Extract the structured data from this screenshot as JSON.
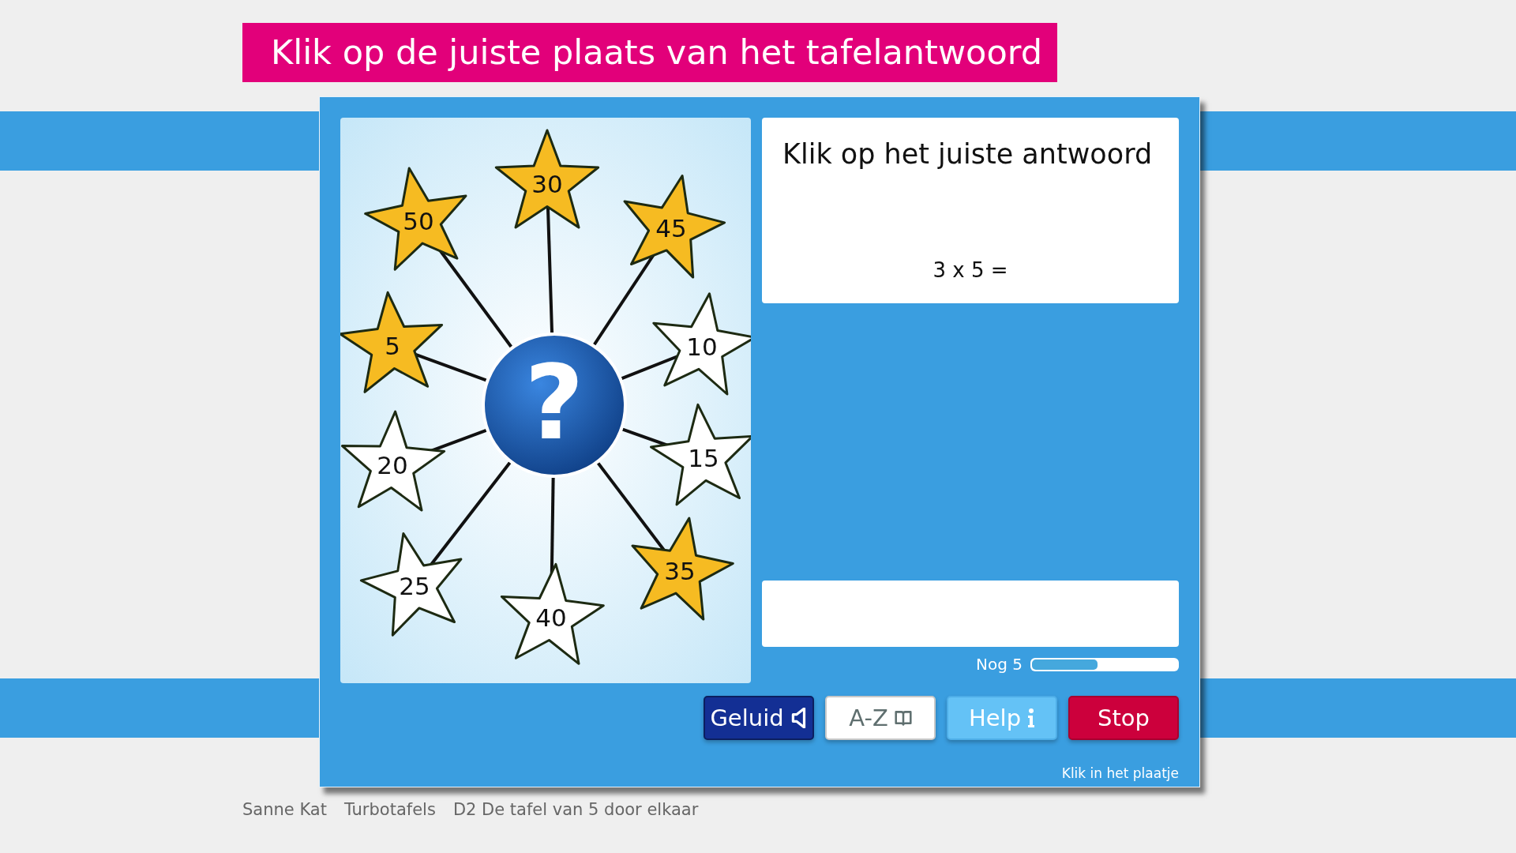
{
  "title": "Klik op de juiste plaats van het tafelantwoord",
  "center_symbol": "?",
  "stars": [
    {
      "label": "30",
      "highlighted": true
    },
    {
      "label": "50",
      "highlighted": true
    },
    {
      "label": "45",
      "highlighted": true
    },
    {
      "label": "5",
      "highlighted": true
    },
    {
      "label": "10",
      "highlighted": false
    },
    {
      "label": "20",
      "highlighted": false
    },
    {
      "label": "15",
      "highlighted": false
    },
    {
      "label": "25",
      "highlighted": false
    },
    {
      "label": "40",
      "highlighted": false
    },
    {
      "label": "35",
      "highlighted": true
    }
  ],
  "question": {
    "heading": "Klik op het juiste antwoord",
    "sum": "3 x 5 ="
  },
  "progress": {
    "label": "Nog 5",
    "level": 0.45
  },
  "buttons": [
    {
      "label": "Geluid",
      "kind": "sound"
    },
    {
      "label": "A-Z",
      "kind": "dictionary"
    },
    {
      "label": "Help",
      "kind": "help"
    },
    {
      "label": "Stop",
      "kind": "stop"
    }
  ],
  "hint": "Klik in het plaatje",
  "footer": [
    "Sanne Kat",
    "Turbotafels",
    "D2 De tafel van 5 door elkaar"
  ]
}
